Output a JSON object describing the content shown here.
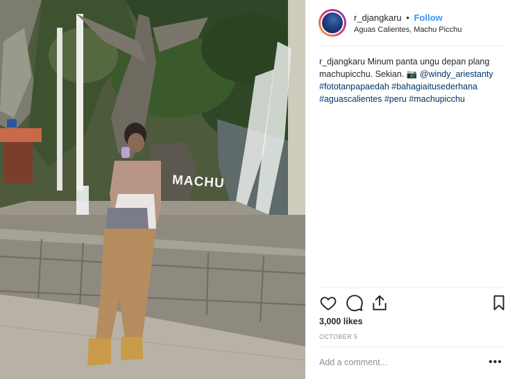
{
  "post": {
    "username": "r_djangkaru",
    "follow_label": "Follow",
    "separator": "•",
    "location": "Aguas Calientes, Machu Picchu"
  },
  "caption": {
    "username": "r_djangkaru",
    "text": "Minum panta ungu depan plang machupicchu. Sekian.",
    "camera_emoji": "📷",
    "mention": "@windy_ariestanty",
    "hashtags": [
      "#fototanpapaedah",
      "#bahagiaitusederhana",
      "#aguascalientes",
      "#peru",
      "#machupicchu"
    ]
  },
  "photo": {
    "sign_text": "MACHU"
  },
  "engagement": {
    "likes": "3,000 likes",
    "date": "OCTOBER 5"
  },
  "comment": {
    "placeholder": "Add a comment...",
    "more_label": "•••"
  },
  "icons": {
    "like": "heart-icon",
    "comment": "comment-bubble-icon",
    "share": "share-icon",
    "save": "bookmark-icon",
    "avatar": "profile-avatar"
  },
  "colors": {
    "link": "#3897f0",
    "hashtag": "#003569",
    "muted": "#8e8e8e",
    "text": "#262626"
  }
}
